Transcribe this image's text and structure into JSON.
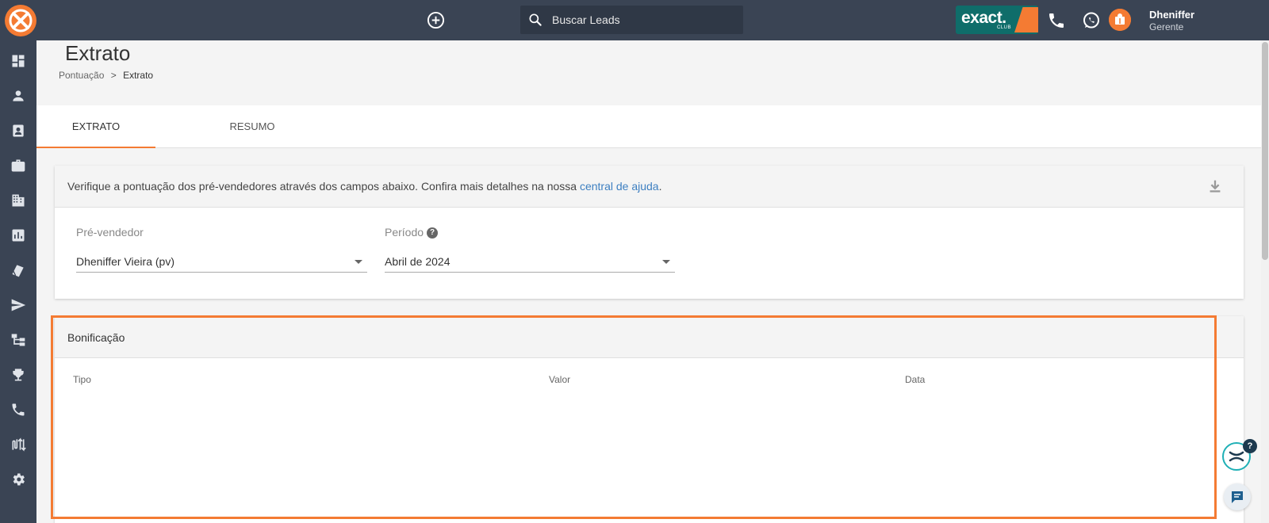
{
  "app": {
    "logo": "exact-sales-logo"
  },
  "topbar": {
    "add_icon": "plus-circle-icon",
    "search": {
      "placeholder": "Buscar Leads"
    },
    "brand": {
      "name": "exact.",
      "sub": "CLUB"
    },
    "user": {
      "name": "Dheniffer",
      "role": "Gerente"
    }
  },
  "sidebar": {
    "items": [
      {
        "icon": "dashboard-icon"
      },
      {
        "icon": "person-icon"
      },
      {
        "icon": "contacts-icon"
      },
      {
        "icon": "briefcase-icon"
      },
      {
        "icon": "building-icon"
      },
      {
        "icon": "chart-icon"
      },
      {
        "icon": "tag-icon"
      },
      {
        "icon": "send-icon"
      },
      {
        "icon": "hierarchy-icon"
      },
      {
        "icon": "trophy-icon"
      },
      {
        "icon": "phone-icon"
      },
      {
        "icon": "routing-icon"
      },
      {
        "icon": "settings-icon"
      }
    ]
  },
  "page": {
    "title": "Extrato",
    "breadcrumb": {
      "parent": "Pontuação",
      "separator": ">",
      "current": "Extrato"
    }
  },
  "tabs": [
    {
      "label": "EXTRATO",
      "active": true
    },
    {
      "label": "RESUMO",
      "active": false
    }
  ],
  "filters": {
    "info_text": "Verifique a pontuação dos pré-vendedores através dos campos abaixo. Confira mais detalhes na nossa ",
    "help_link": "central de ajuda",
    "info_end": ".",
    "seller": {
      "label": "Pré-vendedor",
      "value": "Dheniffer Vieira (pv)"
    },
    "period": {
      "label": "Período",
      "value": "Abril de 2024",
      "help_glyph": "?"
    }
  },
  "bonus": {
    "title": "Bonificação",
    "columns": [
      "Tipo",
      "Valor",
      "Data"
    ]
  },
  "floating": {
    "help_badge": "?"
  },
  "colors": {
    "topbar": "#3a4454",
    "accent": "#f47b33",
    "brand_teal": "#0f6d6a",
    "link": "#3d7fc1"
  }
}
